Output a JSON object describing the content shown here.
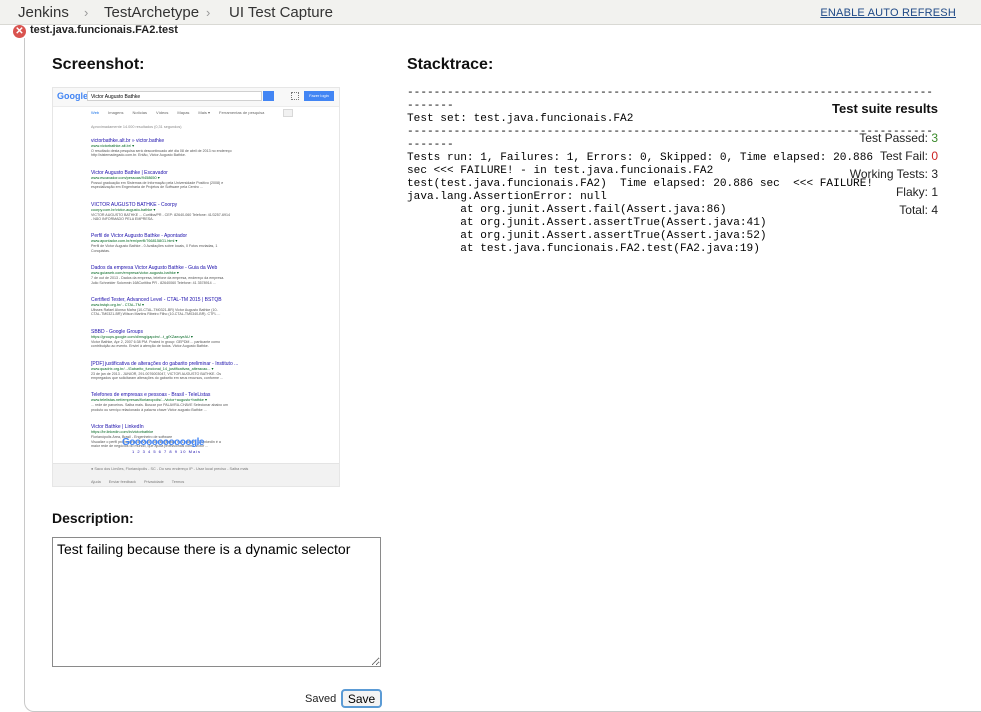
{
  "breadcrumb": {
    "items": [
      "Jenkins",
      "TestArchetype",
      "UI Test Capture"
    ],
    "separator": "›",
    "auto_refresh": "ENABLE AUTO REFRESH"
  },
  "test": {
    "name": "test.java.funcionais.FA2.test",
    "status_icon": "error-x-icon"
  },
  "screenshot": {
    "heading": "Screenshot:",
    "google": {
      "logo": "Google",
      "query": "Victor Augusto Bathke",
      "signin": "Fazer login",
      "tabs": [
        "Web",
        "Imagens",
        "Notícias",
        "Vídeos",
        "Mapas",
        "Mais ▾",
        "Ferramentas de pesquisa"
      ],
      "count": "Aproximadamente 14.000 resultados (0,31 segundos)",
      "results": [
        {
          "t": "victorbathke.alt.br » victor.bathke",
          "u": "www.victorbathke.alt.br/ ▾",
          "s": [
            "O resultado desta pesquisa será descontinuado até dia 08 de abril de 2013 no endereço",
            "http://sistemadegado.com.br. Então, Victor Augusto Bathke."
          ]
        },
        {
          "t": "Victor Augusto Bathke | Escavador",
          "u": "www.escavador.com/pessoas/9458650 ▾",
          "s": [
            "Possui graduação em Sistemas de Informação pela Universidade Positivo (2008) e",
            "especialização em Engenharia de Projetos de Software pela Centro ..."
          ]
        },
        {
          "t": "VICTOR AUGUSTO BATHKE - Coorpy",
          "u": "coorpy.com.br/victor-augusto-bathke ▾",
          "s": [
            "VICTOR AUGUSTO BATHKE ... Curitiba/PR - CEP: 82640-060 Telefone: 41/3257-6914",
            "- NÃO INFORMADO PELA EMPRESA."
          ]
        },
        {
          "t": "Perfil de Victor Augusto Bathke - Apontador",
          "u": "www.apontador.com.br/em/perfil/7668158G1.html ▾",
          "s": [
            "Perfil de Victor Augusto Bathke - 0 Avaliações sobre locais, 0 Fotos enviadas, 1",
            "Conquistas."
          ]
        },
        {
          "t": "Dados da empresa Victor Augusto Bathke - Guia da Web",
          "u": "www.guiaweb.com/empresa/victor-augusto-bathke ▾",
          "s": [
            "7 de out de 2013 - Dados da empresa, telefone da empresa, endereço da empresa.",
            "Julio Schneider Solomnin 168Curitiba PR - 82640060 Telefone: 41 3578914 ..."
          ]
        },
        {
          "t": "Certified Tester, Advanced Level - CTAL-TM 2015 | BSTQB",
          "u": "www.bstqb.org.br/ - CTAL-TM ▾",
          "s": [
            "Ulisses Rafael Alonso Mafra (10-CTAL-TM0321-BR) Victor Augusto Bathke (10-",
            "CTAL-TM0321-BR) Wilson Martins Ribeiro Filho (10-CTAL-TM0340-BR). CTFL ..."
          ]
        },
        {
          "t": "SBBD - Google Groups",
          "u": "https://groups.google.com/d/msg/gapdm/...t_gfXZaeoyeAU ▾",
          "s": [
            "Victor Bathke, Apr 2, 2007 6:38 PM. Posted in group: GEPDM ... particante como",
            "contribuição ao evento. Enviei à atenção de todos. Victor Augusto Bathke."
          ]
        },
        {
          "t": "[PDF] justificativa de alterações do gabarito preliminar - Instituto ...",
          "u": "www.quadrix.org.br/.../Gabarito_funcional_14_justificativas_alteracao... ▾",
          "s": [
            "23 de jan de 2013 - JUNIOR, 291.0076003047, VICTOR AUGUSTO BATHKE. Os",
            "empregados que solicitaram alterações do gabarito em seus recursos, conforme ..."
          ]
        },
        {
          "t": "Telefones de empresas e pessoas - Brasil - TeleListas",
          "u": "www.telelistas.net/empresas/florianopolis/.../victor+augusto+bathke ▾",
          "s": [
            "... rede de parceiros. Saiba mais. Buscar por PALAVRA-CHAVE Selecionar abaixo um",
            "produto ou serviço relacionado à palavra chave Victor augusto Bathke ..."
          ]
        },
        {
          "t": "Victor Bathke | LinkedIn",
          "u": "https://br.linkedin.com/in/victorbathke",
          "s": [
            "Florianópolis Área, Brasil - Engenheiro de software",
            "Visualize o perfil profissional de Victor Bathke (Brasil) no LinkedIn. O LinkedIn é a",
            "maior rede de negócios do mundo, que ajuda profissionais como Victor ..."
          ]
        }
      ],
      "pager": "Gooooooooooogle",
      "pages": "1 2 3 4 5 6 7 8 9 10",
      "next": "Mais",
      "footer_loc": "● Saco dos Limões, Florianópolis - SC - Do seu endereço IP - Usar local preciso - Saiba mais",
      "footer_links": [
        "Ajuda",
        "Enviar feedback",
        "Privacidade",
        "Termos"
      ]
    }
  },
  "description": {
    "heading": "Description:",
    "value": "Test failing because there is a dynamic selector",
    "saved": "Saved",
    "save": "Save"
  },
  "stacktrace": {
    "heading": "Stacktrace:",
    "text": "-------------------------------------------------------------------------------\n-------\nTest set: test.java.funcionais.FA2\n-------------------------------------------------------------------------------\n-------\nTests run: 1, Failures: 1, Errors: 0, Skipped: 0, Time elapsed: 20.886\nsec <<< FAILURE! - in test.java.funcionais.FA2\ntest(test.java.funcionais.FA2)  Time elapsed: 20.886 sec  <<< FAILURE!\njava.lang.AssertionError: null\n\tat org.junit.Assert.fail(Assert.java:86)\n\tat org.junit.Assert.assertTrue(Assert.java:41)\n\tat org.junit.Assert.assertTrue(Assert.java:52)\n\tat test.java.funcionais.FA2.test(FA2.java:19)"
  },
  "suite": {
    "title": "Test suite results",
    "passed_label": "Test Passed: ",
    "passed": "3",
    "fail_label": "Test Fail: ",
    "fail": "0",
    "working_label": "Working Tests: ",
    "working": "3",
    "flaky_label": "Flaky: ",
    "flaky": "1",
    "total_label": "Total: ",
    "total": "4"
  },
  "colors": {
    "fail_icon": "#d9534f",
    "link": "#204a87",
    "pass": "#3a8a2a",
    "fail": "#cc2222"
  }
}
